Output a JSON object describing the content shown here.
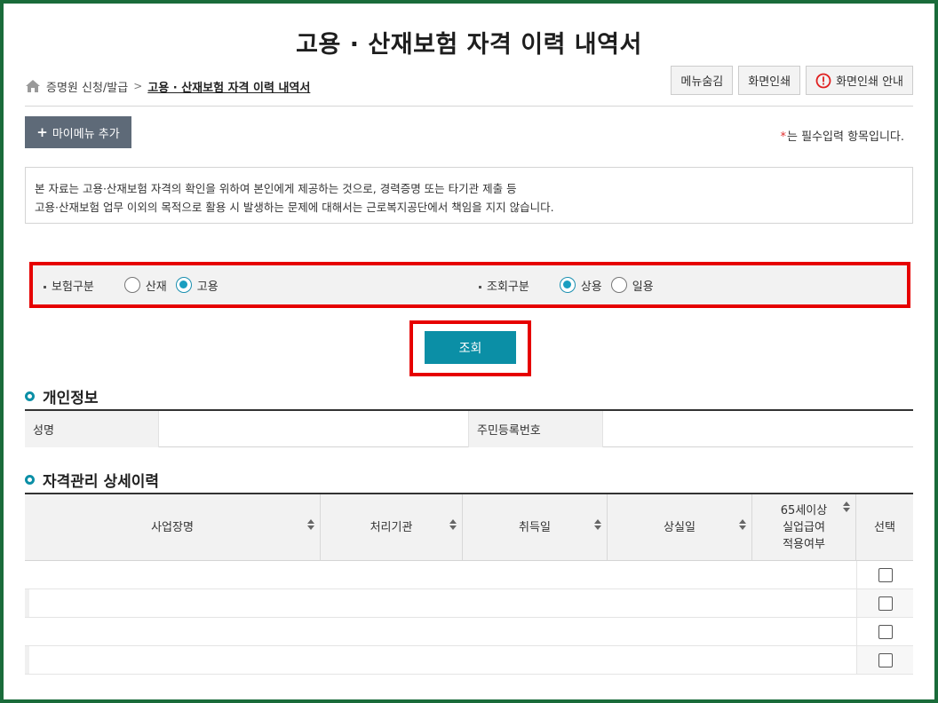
{
  "page": {
    "title": "고용 · 산재보험 자격 이력 내역서"
  },
  "breadcrumb": {
    "items": [
      "증명원 신청/발급",
      "고용 · 산재보험 자격 이력 내역서"
    ]
  },
  "utility_buttons": {
    "hide_menu": "메뉴숨김",
    "print_screen": "화면인쇄",
    "print_guide": "화면인쇄 안내"
  },
  "my_menu": {
    "plus": "+",
    "label": "마이메뉴 추가"
  },
  "required_note": {
    "star": "*",
    "text": "는 필수입력 항목입니다."
  },
  "notice": {
    "line1": "본 자료는 고용·산재보험 자격의 확인을 위하여 본인에게 제공하는 것으로, 경력증명 또는 타기관 제출 등",
    "line2": "고용·산재보험 업무 이외의 목적으로 활용 시 발생하는 문제에 대해서는 근로복지공단에서 책임을 지지 않습니다."
  },
  "search": {
    "insurance_type": {
      "label": "보험구분",
      "options": [
        {
          "label": "산재",
          "selected": false
        },
        {
          "label": "고용",
          "selected": true
        }
      ]
    },
    "query_type": {
      "label": "조회구분",
      "options": [
        {
          "label": "상용",
          "selected": true
        },
        {
          "label": "일용",
          "selected": false
        }
      ]
    },
    "query_button": "조회"
  },
  "personal_info": {
    "title": "개인정보",
    "name_label": "성명",
    "name_value": "",
    "rrn_label": "주민등록번호",
    "rrn_value": ""
  },
  "detail_history": {
    "title": "자격관리 상세이력",
    "columns": [
      "사업장명",
      "처리기관",
      "취득일",
      "상실일",
      "65세이상 실업급여 적용여부",
      "선택"
    ],
    "column_65_lines": [
      "65세이상",
      "실업급여",
      "적용여부"
    ],
    "rows": [
      {
        "checked": false
      },
      {
        "checked": false
      },
      {
        "checked": false
      },
      {
        "checked": false
      }
    ]
  },
  "colors": {
    "frame": "#1a6b3a",
    "highlight": "#e60000",
    "accent": "#0b8fa6",
    "my_menu_bg": "#5e6a78"
  },
  "icons": {
    "home": "home-icon",
    "alert": "alert-circle-icon",
    "sort": "sort-updown-icon",
    "section": "ring-bullet-icon"
  }
}
